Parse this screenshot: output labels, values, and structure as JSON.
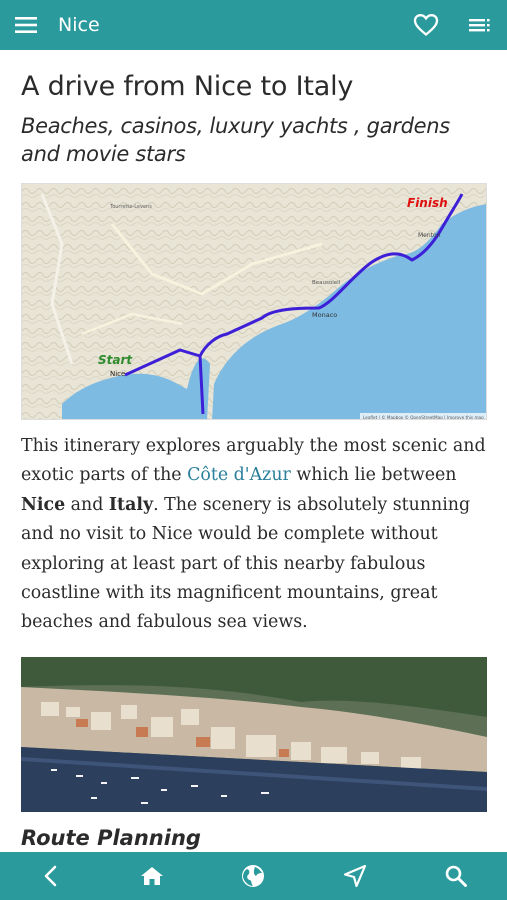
{
  "appbar": {
    "title": "Nice",
    "menu_icon": "hamburger-menu-icon",
    "favorite_icon": "heart-icon",
    "contents_icon": "table-of-contents-icon"
  },
  "article": {
    "title": "A drive from Nice to Italy",
    "subtitle": "Beaches, casinos, luxury yachts , gardens and movie stars",
    "map": {
      "start_label": "Start",
      "finish_label": "Finish",
      "places": [
        "Nice",
        "Monaco",
        "Menton",
        "Beausoleil",
        "Tourrette-Levens"
      ],
      "attribution": "Leaflet | © Mapbox © OpenStreetMap | Improve this map"
    },
    "paragraph": {
      "p1": "This itinerary explores arguably the most scenic and exotic parts of the ",
      "link": "Côte d'Azur",
      "p2": " which lie between ",
      "b1": "Nice",
      "p3": " and ",
      "b2": "Italy",
      "p4": ". The scenery is absolutely stunning and no visit to Nice would be complete without exploring at least part of this nearby fabulous coastline with its magnificent mountains, great beaches and fabulous sea views."
    },
    "section_heading": "Route Planning"
  },
  "bottom_nav": [
    "back-icon",
    "home-icon",
    "globe-icon",
    "location-arrow-icon",
    "search-icon"
  ],
  "colors": {
    "accent": "#2a9a9c",
    "link": "#2a7f9a",
    "sea": "#7ebbe2",
    "route": "#3c1fd6",
    "start": "#2e8b2e",
    "finish": "#e01010"
  }
}
